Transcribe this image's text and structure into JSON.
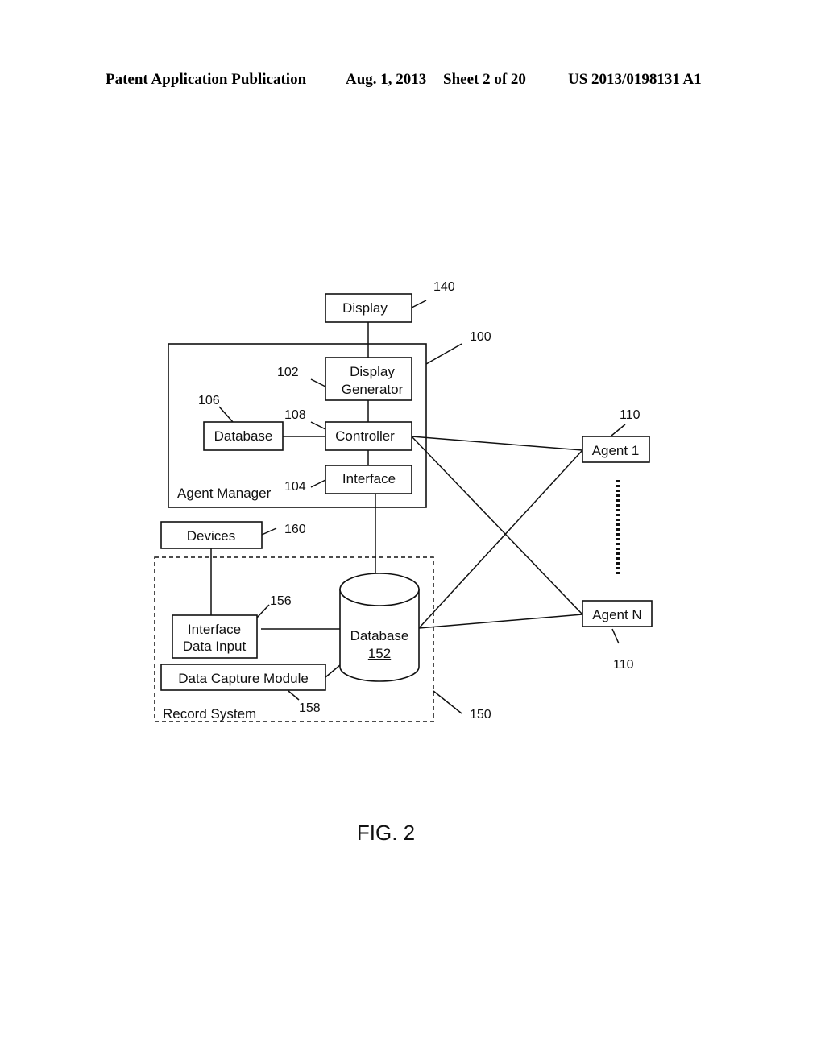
{
  "header": {
    "publication": "Patent Application Publication",
    "date": "Aug. 1, 2013",
    "sheet": "Sheet 2 of 20",
    "patent_number": "US 2013/0198131 A1"
  },
  "diagram": {
    "figure_label": "FIG. 2",
    "nodes": {
      "display": {
        "label": "Display",
        "ref": "140"
      },
      "agent_manager": {
        "label": "Agent Manager",
        "ref": "100"
      },
      "display_generator": {
        "line1": "Display",
        "line2": "Generator",
        "ref": "102"
      },
      "database_am": {
        "label": "Database",
        "ref": "106"
      },
      "controller": {
        "label": "Controller",
        "ref": "108"
      },
      "interface": {
        "label": "Interface",
        "ref": "104"
      },
      "devices": {
        "label": "Devices",
        "ref": "160"
      },
      "record_system": {
        "label": "Record System",
        "ref": "150"
      },
      "interface_data_input": {
        "line1": "Interface",
        "line2": "Data Input",
        "ref": "156"
      },
      "data_capture_module": {
        "label": "Data Capture Module",
        "ref": "158"
      },
      "database_rs": {
        "label": "Database",
        "id": "152"
      },
      "agent_1": {
        "label": "Agent 1",
        "ref": "110"
      },
      "agent_n": {
        "label": "Agent N",
        "ref": "110"
      }
    },
    "edges": [
      [
        "display",
        "display_generator"
      ],
      [
        "display_generator",
        "controller"
      ],
      [
        "database_am",
        "controller"
      ],
      [
        "controller",
        "interface"
      ],
      [
        "interface",
        "database_rs"
      ],
      [
        "devices",
        "interface_data_input"
      ],
      [
        "interface_data_input",
        "database_rs"
      ],
      [
        "data_capture_module",
        "database_rs"
      ],
      [
        "controller",
        "agent_1"
      ],
      [
        "controller",
        "agent_n"
      ],
      [
        "database_rs",
        "agent_1"
      ],
      [
        "database_rs",
        "agent_n"
      ]
    ]
  }
}
